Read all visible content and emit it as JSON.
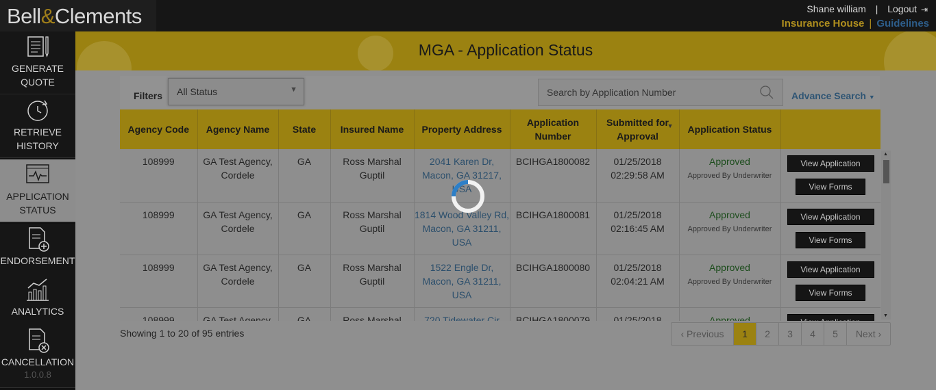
{
  "brand": {
    "name_part1": "Bell",
    "amp": "&",
    "name_part2": "Clements"
  },
  "user": {
    "name": "Shane william",
    "separator": "|",
    "logout": "Logout"
  },
  "links": {
    "insurance_house": "Insurance House",
    "separator": "|",
    "guidelines": "Guidelines"
  },
  "sidebar": {
    "items": [
      {
        "label": "GENERATE QUOTE",
        "icon": "document-pencil-icon"
      },
      {
        "label": "RETRIEVE HISTORY",
        "icon": "history-icon"
      },
      {
        "label": "APPLICATION STATUS",
        "icon": "monitor-pulse-icon",
        "active": true
      },
      {
        "label": "ENDORSEMENT",
        "icon": "document-plus-icon"
      },
      {
        "label": "ANALYTICS",
        "icon": "chart-icon"
      },
      {
        "label": "CANCELLATION",
        "icon": "document-cancel-icon"
      }
    ],
    "version": "1.0.0.8"
  },
  "page": {
    "title": "MGA - Application Status"
  },
  "filters": {
    "label": "Filters",
    "status_value": "All Status",
    "search_placeholder": "Search by Application Number",
    "advance_search": "Advance Search"
  },
  "table": {
    "headers": [
      "Agency Code",
      "Agency Name",
      "State",
      "Insured Name",
      "Property Address",
      "Application Number",
      "Submitted for Approval",
      "Application Status",
      ""
    ],
    "view_application_label": "View Application",
    "view_forms_label": "View Forms",
    "rows": [
      {
        "code": "108999",
        "agency": "GA Test Agency, Cordele",
        "state": "GA",
        "insured": "Ross Marshal Guptil",
        "address": "2041 Karen Dr, Macon, GA 31217, USA",
        "app_no": "BCIHGA1800082",
        "submitted": "01/25/2018 02:29:58 AM",
        "status": "Approved",
        "status_note": "Approved By Underwriter"
      },
      {
        "code": "108999",
        "agency": "GA Test Agency, Cordele",
        "state": "GA",
        "insured": "Ross Marshal Guptil",
        "address": "1814 Wood Valley Rd, Macon, GA 31211, USA",
        "app_no": "BCIHGA1800081",
        "submitted": "01/25/2018 02:16:45 AM",
        "status": "Approved",
        "status_note": "Approved By Underwriter"
      },
      {
        "code": "108999",
        "agency": "GA Test Agency, Cordele",
        "state": "GA",
        "insured": "Ross Marshal Guptil",
        "address": "1522 Engle Dr, Macon, GA 31211, USA",
        "app_no": "BCIHGA1800080",
        "submitted": "01/25/2018 02:04:21 AM",
        "status": "Approved",
        "status_note": "Approved By Underwriter"
      },
      {
        "code": "108999",
        "agency": "GA Test Agency, Cordele",
        "state": "GA",
        "insured": "Ross Marshal Guptil",
        "address": "720 Tidewater Cir",
        "app_no": "BCIHGA1800079",
        "submitted": "01/25/2018",
        "status": "Approved",
        "status_note": ""
      }
    ]
  },
  "footer": {
    "showing": "Showing 1 to 20 of 95 entries"
  },
  "pagination": {
    "previous": "Previous",
    "next": "Next",
    "pages": [
      "1",
      "2",
      "3",
      "4",
      "5"
    ],
    "current": "1"
  },
  "colors": {
    "gold": "#9b8211",
    "overlay": "#8f8f8f",
    "link": "#2c4f6c",
    "approved": "#1d4d1d"
  }
}
